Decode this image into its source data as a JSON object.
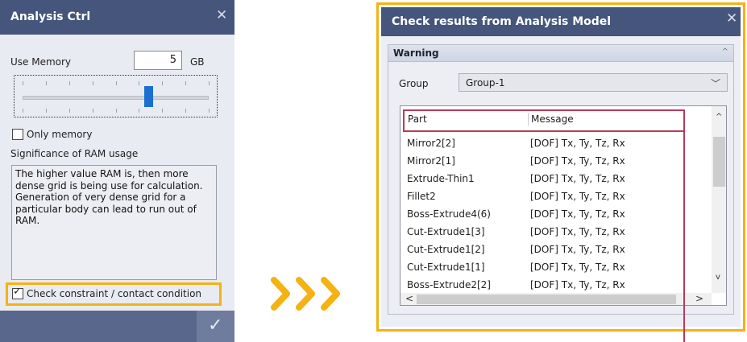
{
  "analysis_ctrl": {
    "title": "Analysis Ctrl",
    "close_glyph": "✕",
    "use_memory_label": "Use Memory",
    "memory_value": "5",
    "memory_unit": "GB",
    "slider_level_fraction": 0.65,
    "only_memory_label": "Only memory",
    "only_memory_checked": false,
    "significance_label": "Significance of RAM usage",
    "description": "The higher value RAM is, then more dense grid is being use for calculation. Generation of very dense grid for a particular body can lead to run out of RAM.",
    "check_constraint_label": "Check constraint / contact condition",
    "check_constraint_checked": true,
    "check_glyph": "✓",
    "ok_glyph": "✓"
  },
  "check_results": {
    "title": "Check results from Analysis Model",
    "close_glyph": "✕",
    "section_title": "Warning",
    "section_caret": "^",
    "group_label": "Group",
    "group_value": "Group-1",
    "dropdown_glyph": "﹀",
    "columns": [
      "Part",
      "Message"
    ],
    "rows": [
      {
        "part": "Mirror2[2]",
        "message": "[DOF] Tx, Ty, Tz, Rx"
      },
      {
        "part": "Mirror2[1]",
        "message": "[DOF] Tx, Ty, Tz, Rx"
      },
      {
        "part": "Extrude-Thin1",
        "message": "[DOF] Tx, Ty, Tz, Rx"
      },
      {
        "part": "Fillet2",
        "message": "[DOF] Tx, Ty, Tz, Rx"
      },
      {
        "part": "Boss-Extrude4(6)",
        "message": "[DOF] Tx, Ty, Tz, Rx"
      },
      {
        "part": "Cut-Extrude1[3]",
        "message": "[DOF] Tx, Ty, Tz, Rx"
      },
      {
        "part": "Cut-Extrude1[2]",
        "message": "[DOF] Tx, Ty, Tz, Rx"
      },
      {
        "part": "Cut-Extrude1[1]",
        "message": "[DOF] Tx, Ty, Tz, Rx"
      },
      {
        "part": "Boss-Extrude2[2]",
        "message": "[DOF] Tx, Ty, Tz, Rx"
      }
    ],
    "scroll_up": "^",
    "scroll_down": "v",
    "scroll_left": "<",
    "scroll_right": ">"
  },
  "colors": {
    "accent_orange": "#f4b213",
    "titlebar": "#45557b",
    "highlight_red": "#b83a5a",
    "slider_thumb": "#1a6fd0"
  }
}
